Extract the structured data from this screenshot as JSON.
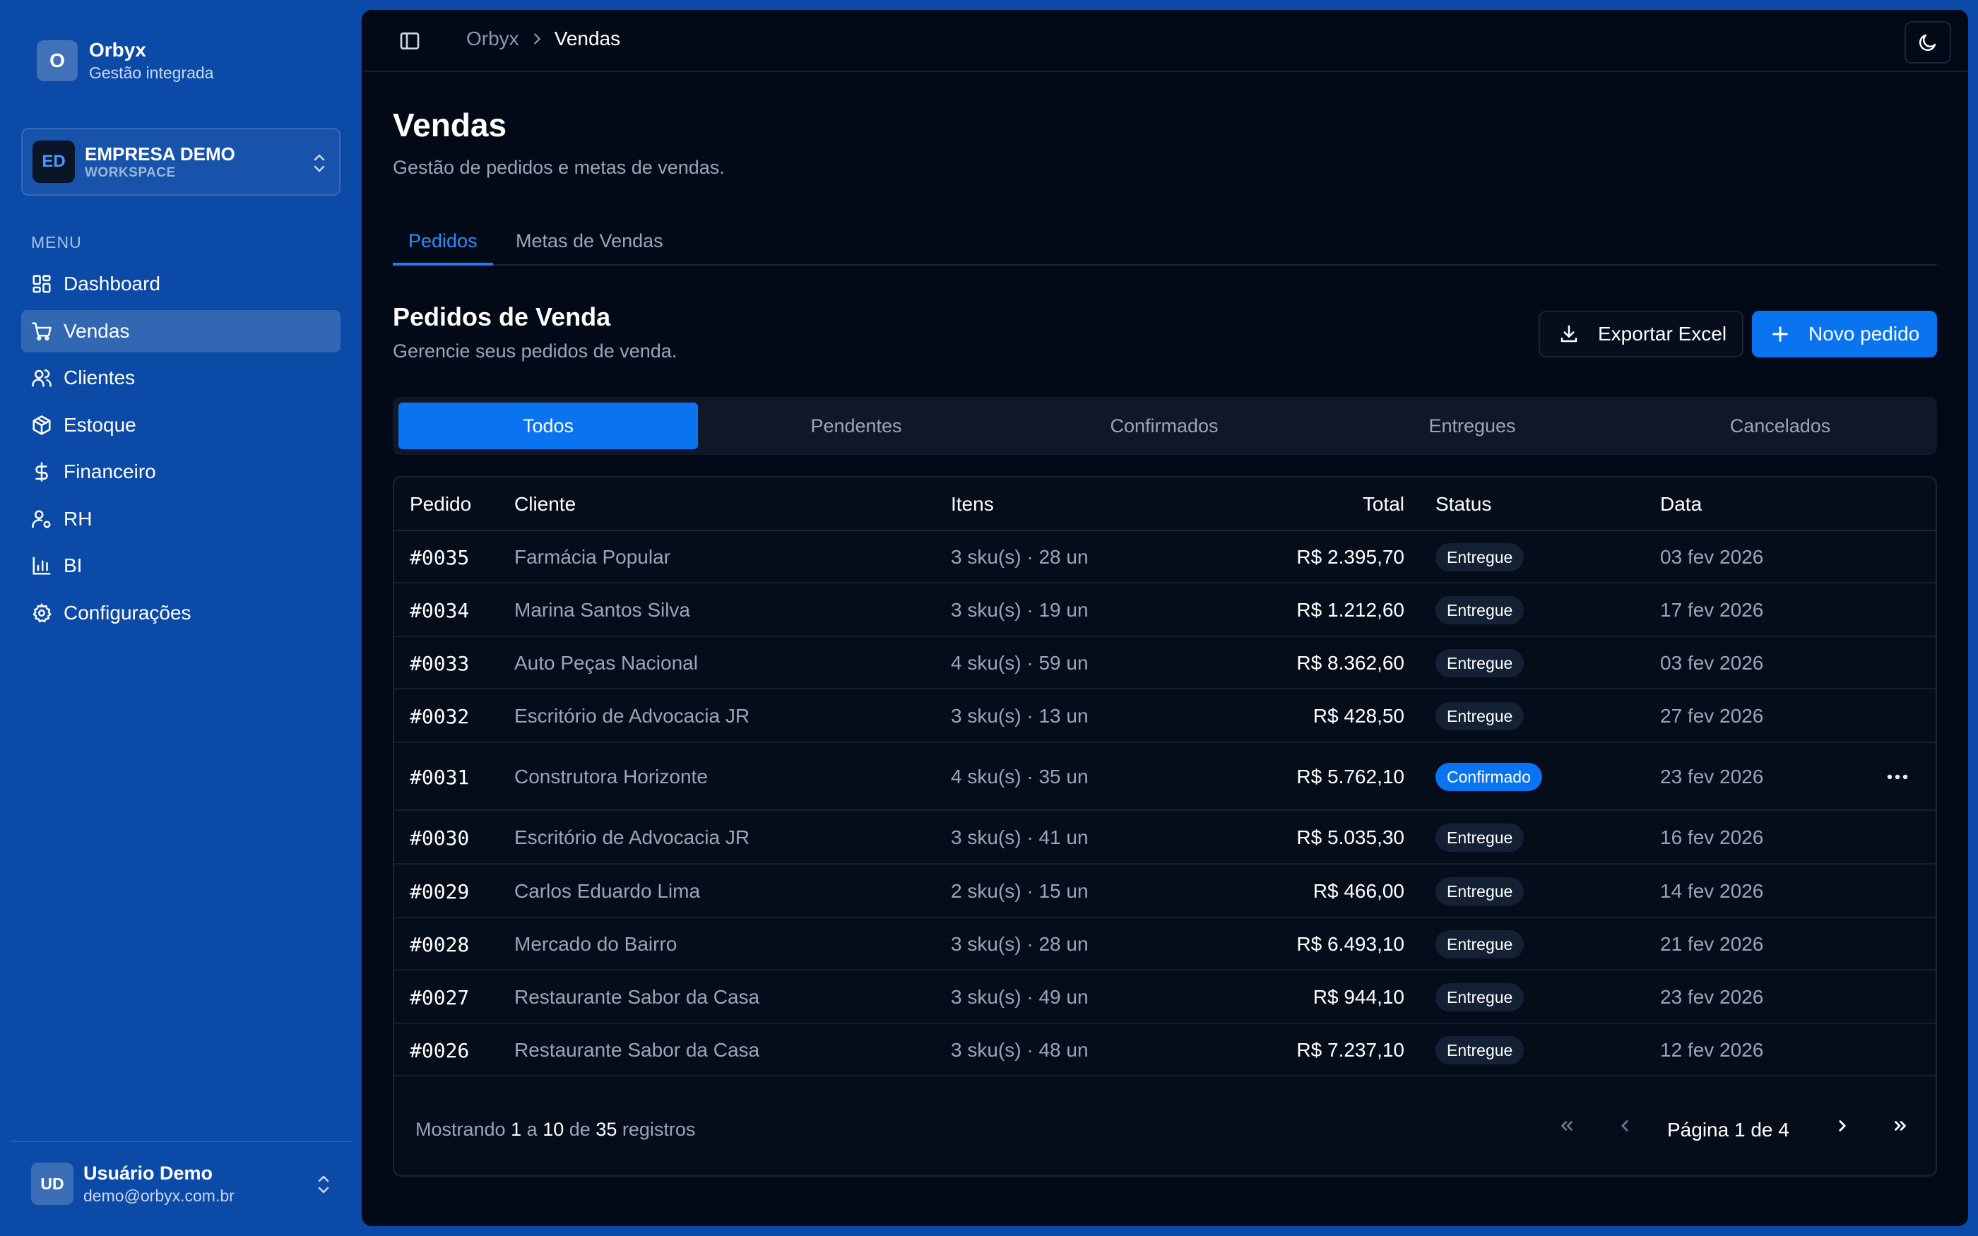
{
  "brand": {
    "logo": "O",
    "name": "Orbyx",
    "subtitle": "Gestão integrada"
  },
  "workspace": {
    "initials": "ED",
    "name": "EMPRESA DEMO",
    "type": "WORKSPACE"
  },
  "sidebar": {
    "menu_label": "MENU",
    "items": [
      {
        "label": "Dashboard",
        "icon": "dashboard-icon",
        "active": false
      },
      {
        "label": "Vendas",
        "icon": "cart-icon",
        "active": true
      },
      {
        "label": "Clientes",
        "icon": "users-icon",
        "active": false
      },
      {
        "label": "Estoque",
        "icon": "package-icon",
        "active": false
      },
      {
        "label": "Financeiro",
        "icon": "dollar-icon",
        "active": false
      },
      {
        "label": "RH",
        "icon": "user-cog-icon",
        "active": false
      },
      {
        "label": "BI",
        "icon": "bar-chart-icon",
        "active": false
      },
      {
        "label": "Configurações",
        "icon": "gear-icon",
        "active": false
      }
    ]
  },
  "user": {
    "initials": "UD",
    "name": "Usuário Demo",
    "email": "demo@orbyx.com.br"
  },
  "breadcrumb": {
    "root": "Orbyx",
    "current": "Vendas"
  },
  "page": {
    "title": "Vendas",
    "subtitle": "Gestão de pedidos e metas de vendas."
  },
  "tabs": [
    {
      "label": "Pedidos",
      "active": true
    },
    {
      "label": "Metas de Vendas",
      "active": false
    }
  ],
  "section": {
    "title": "Pedidos de Venda",
    "subtitle": "Gerencie seus pedidos de venda."
  },
  "actions": {
    "export_label": "Exportar Excel",
    "new_label": "Novo pedido"
  },
  "filters": [
    {
      "label": "Todos",
      "active": true
    },
    {
      "label": "Pendentes",
      "active": false
    },
    {
      "label": "Confirmados",
      "active": false
    },
    {
      "label": "Entregues",
      "active": false
    },
    {
      "label": "Cancelados",
      "active": false
    }
  ],
  "table": {
    "headers": {
      "id": "Pedido",
      "client": "Cliente",
      "items": "Itens",
      "total": "Total",
      "status": "Status",
      "date": "Data"
    },
    "rows": [
      {
        "id": "#0035",
        "client": "Farmácia Popular",
        "items": "3 sku(s) · 28 un",
        "total": "R$ 2.395,70",
        "status": "Entregue",
        "date": "03 fev 2026"
      },
      {
        "id": "#0034",
        "client": "Marina Santos Silva",
        "items": "3 sku(s) · 19 un",
        "total": "R$ 1.212,60",
        "status": "Entregue",
        "date": "17 fev 2026"
      },
      {
        "id": "#0033",
        "client": "Auto Peças Nacional",
        "items": "4 sku(s) · 59 un",
        "total": "R$ 8.362,60",
        "status": "Entregue",
        "date": "03 fev 2026"
      },
      {
        "id": "#0032",
        "client": "Escritório de Advocacia JR",
        "items": "3 sku(s) · 13 un",
        "total": "R$ 428,50",
        "status": "Entregue",
        "date": "27 fev 2026"
      },
      {
        "id": "#0031",
        "client": "Construtora Horizonte",
        "items": "4 sku(s) · 35 un",
        "total": "R$ 5.762,10",
        "status": "Confirmado",
        "date": "23 fev 2026",
        "hovered": true
      },
      {
        "id": "#0030",
        "client": "Escritório de Advocacia JR",
        "items": "3 sku(s) · 41 un",
        "total": "R$ 5.035,30",
        "status": "Entregue",
        "date": "16 fev 2026"
      },
      {
        "id": "#0029",
        "client": "Carlos Eduardo Lima",
        "items": "2 sku(s) · 15 un",
        "total": "R$ 466,00",
        "status": "Entregue",
        "date": "14 fev 2026"
      },
      {
        "id": "#0028",
        "client": "Mercado do Bairro",
        "items": "3 sku(s) · 28 un",
        "total": "R$ 6.493,10",
        "status": "Entregue",
        "date": "21 fev 2026"
      },
      {
        "id": "#0027",
        "client": "Restaurante Sabor da Casa",
        "items": "3 sku(s) · 49 un",
        "total": "R$ 944,10",
        "status": "Entregue",
        "date": "23 fev 2026"
      },
      {
        "id": "#0026",
        "client": "Restaurante Sabor da Casa",
        "items": "3 sku(s) · 48 un",
        "total": "R$ 7.237,10",
        "status": "Entregue",
        "date": "12 fev 2026"
      }
    ]
  },
  "pagination": {
    "showing_prefix": "Mostrando",
    "from": "1",
    "to_word": "a",
    "to": "10",
    "of_word": "de",
    "total": "35",
    "suffix": "registros",
    "page_label": "Página 1 de 4"
  },
  "colors": {
    "accent": "#0a74f0",
    "sidebar": "#0b4aa6",
    "panel": "#030a17"
  }
}
